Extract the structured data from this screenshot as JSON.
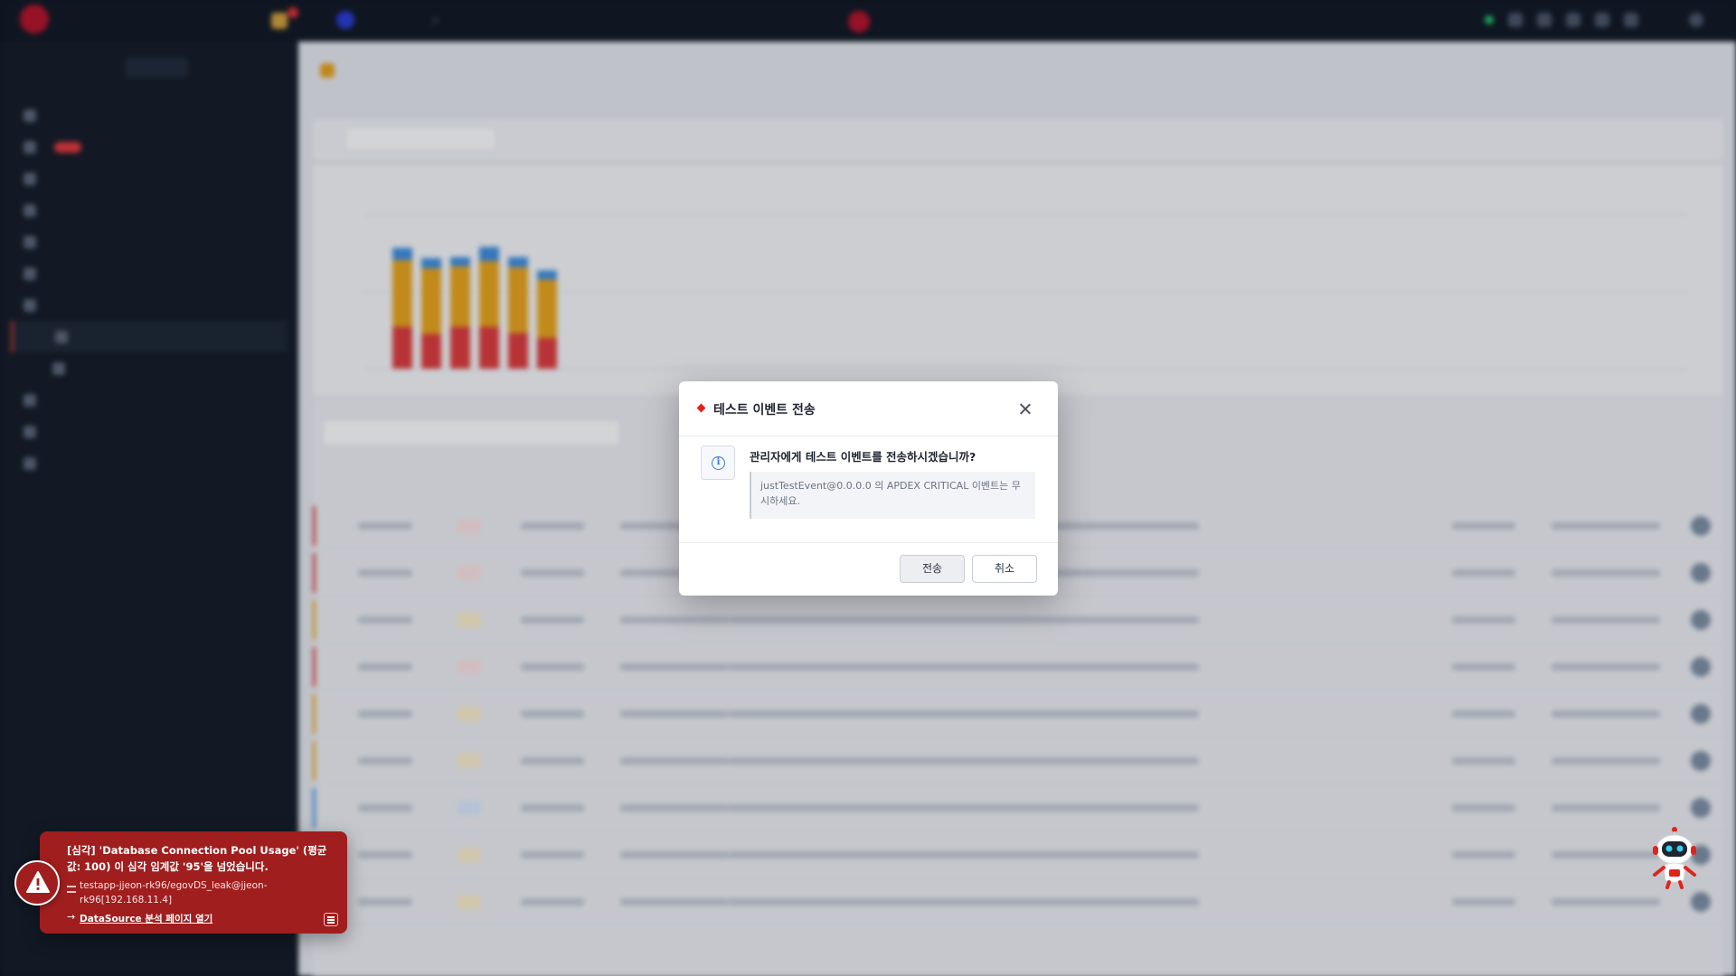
{
  "modal": {
    "title": "테스트 이벤트 전송",
    "question": "관리자에게 테스트 이벤트를 전송하시겠습니까?",
    "note": "justTestEvent@0.0.0.0 의 APDEX CRITICAL 이벤트는 무시하세요.",
    "send_label": "전송",
    "cancel_label": "취소"
  },
  "toast": {
    "message": "[심각] 'Database Connection Pool Usage' (평균값: 100) 이 심각 임계값 '95'을 넘었습니다.",
    "source": "testapp-jjeon-rk96/egovDS_leak@jjeon-rk96[192.168.11.4]",
    "link_label": "DataSource 분석 페이지 열기"
  },
  "colors": {
    "accent_red": "#e2231a",
    "toast_bg": "#a01e1e",
    "info_blue": "#3a78d8",
    "bar_critical": "#de3b3b",
    "bar_warning": "#eaa51b",
    "bar_info": "#3f8fe0"
  },
  "icons": {
    "modal_title": "red-diamond-icon",
    "modal_info": "info-circle-icon",
    "modal_close": "close-icon",
    "toast_badge": "warning-triangle-icon",
    "toast_source": "server-icon",
    "toast_link": "arrow-right-icon",
    "toast_list": "list-icon",
    "assistant": "robot-assistant-icon"
  },
  "background_chart": {
    "stacks": [
      {
        "critical": 41,
        "warning": 65,
        "info": 12
      },
      {
        "critical": 34,
        "warning": 64,
        "info": 10
      },
      {
        "critical": 41,
        "warning": 59,
        "info": 9
      },
      {
        "critical": 41,
        "warning": 64,
        "info": 14
      },
      {
        "critical": 35,
        "warning": 64,
        "info": 10
      },
      {
        "critical": 30,
        "warning": 57,
        "info": 9
      }
    ],
    "ymax": 150
  },
  "background_rows": [
    {
      "severity": "crit",
      "bar": "#de3b3b"
    },
    {
      "severity": "crit",
      "bar": "#de3b3b"
    },
    {
      "severity": "warn",
      "bar": "#eaa51b"
    },
    {
      "severity": "crit",
      "bar": "#de3b3b"
    },
    {
      "severity": "warn",
      "bar": "#eaa51b"
    },
    {
      "severity": "warn",
      "bar": "#eaa51b"
    },
    {
      "severity": "info",
      "bar": "#3f8fe0"
    },
    {
      "severity": "warn",
      "bar": "#eaa51b"
    },
    {
      "severity": "warn",
      "bar": "#eaa51b"
    }
  ]
}
